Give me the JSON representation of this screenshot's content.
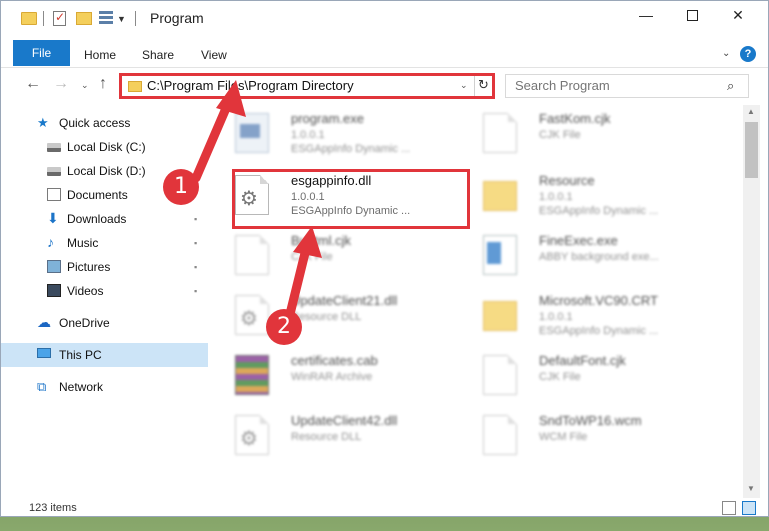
{
  "window": {
    "title": "Program",
    "controls": {
      "minimize": "—",
      "maximize": "",
      "close": "✕"
    }
  },
  "ribbon": {
    "tabs": [
      "File",
      "Home",
      "Share",
      "View"
    ],
    "chevron": "⌄",
    "help": "?"
  },
  "nav": {
    "back": "←",
    "forward": "→",
    "recent": "⌄",
    "up": "↑",
    "address": "C:\\Program Files\\Program Directory",
    "dropdown": "⌄",
    "refresh": "↻",
    "search_placeholder": "Search Program",
    "search_icon": "⌕"
  },
  "sidebar": {
    "items": [
      {
        "label": "Quick access",
        "icon": "star-icon",
        "glyph": "★"
      },
      {
        "label": "Local Disk (C:)",
        "icon": "drive-icon",
        "glyph": ""
      },
      {
        "label": "Local Disk (D:)",
        "icon": "drive-icon",
        "glyph": ""
      },
      {
        "label": "Documents",
        "icon": "documents-icon",
        "glyph": ""
      },
      {
        "label": "Downloads",
        "icon": "downloads-icon",
        "glyph": "⬇"
      },
      {
        "label": "Music",
        "icon": "music-icon",
        "glyph": "♪"
      },
      {
        "label": "Pictures",
        "icon": "pictures-icon",
        "glyph": ""
      },
      {
        "label": "Videos",
        "icon": "videos-icon",
        "glyph": ""
      },
      {
        "label": "OneDrive",
        "icon": "cloud-icon",
        "glyph": "☁"
      },
      {
        "label": "This PC",
        "icon": "computer-icon",
        "glyph": ""
      },
      {
        "label": "Network",
        "icon": "network-icon",
        "glyph": "⧉"
      }
    ],
    "pin_glyph": "📌"
  },
  "files": [
    {
      "name": "program.exe",
      "line2": "1.0.0.1",
      "line3": "ESGAppInfo Dynamic ...",
      "icon": "exe-icon",
      "blurred": true
    },
    {
      "name": "FastKom.cjk",
      "line2": "CJK File",
      "line3": "",
      "icon": "document-icon",
      "blurred": true
    },
    {
      "name": "esgappinfo.dll",
      "line2": "1.0.0.1",
      "line3": "ESGAppInfo Dynamic ...",
      "icon": "gear-document-icon",
      "blurred": false
    },
    {
      "name": "Resource",
      "line2": "1.0.0.1",
      "line3": "ESGAppInfo Dynamic ...",
      "icon": "folder-icon",
      "blurred": true
    },
    {
      "name": "Buhtml.cjk",
      "line2": "CJK File",
      "line3": "",
      "icon": "document-icon",
      "blurred": true
    },
    {
      "name": "FineExec.exe",
      "line2": "ABBY background exe...",
      "line3": "",
      "icon": "app-icon",
      "blurred": true
    },
    {
      "name": "UpdateClient21.dll",
      "line2": "Resource DLL",
      "line3": "",
      "icon": "gear-document-icon",
      "blurred": true
    },
    {
      "name": "Microsoft.VC90.CRT",
      "line2": "1.0.0.1",
      "line3": "ESGAppInfo Dynamic ...",
      "icon": "folder-icon",
      "blurred": true
    },
    {
      "name": "certificates.cab",
      "line2": "WinRAR Archive",
      "line3": "",
      "icon": "archive-icon",
      "blurred": true
    },
    {
      "name": "DefaultFont.cjk",
      "line2": "CJK File",
      "line3": "",
      "icon": "document-icon",
      "blurred": true
    },
    {
      "name": "UpdateClient42.dll",
      "line2": "Resource DLL",
      "line3": "",
      "icon": "gear-document-icon",
      "blurred": true
    },
    {
      "name": "SndToWP16.wcm",
      "line2": "WCM File",
      "line3": "",
      "icon": "document-icon",
      "blurred": true
    }
  ],
  "status": {
    "item_count": "123 items"
  },
  "annotations": {
    "step1": "1",
    "step2": "2",
    "accent": "#e1353b"
  }
}
